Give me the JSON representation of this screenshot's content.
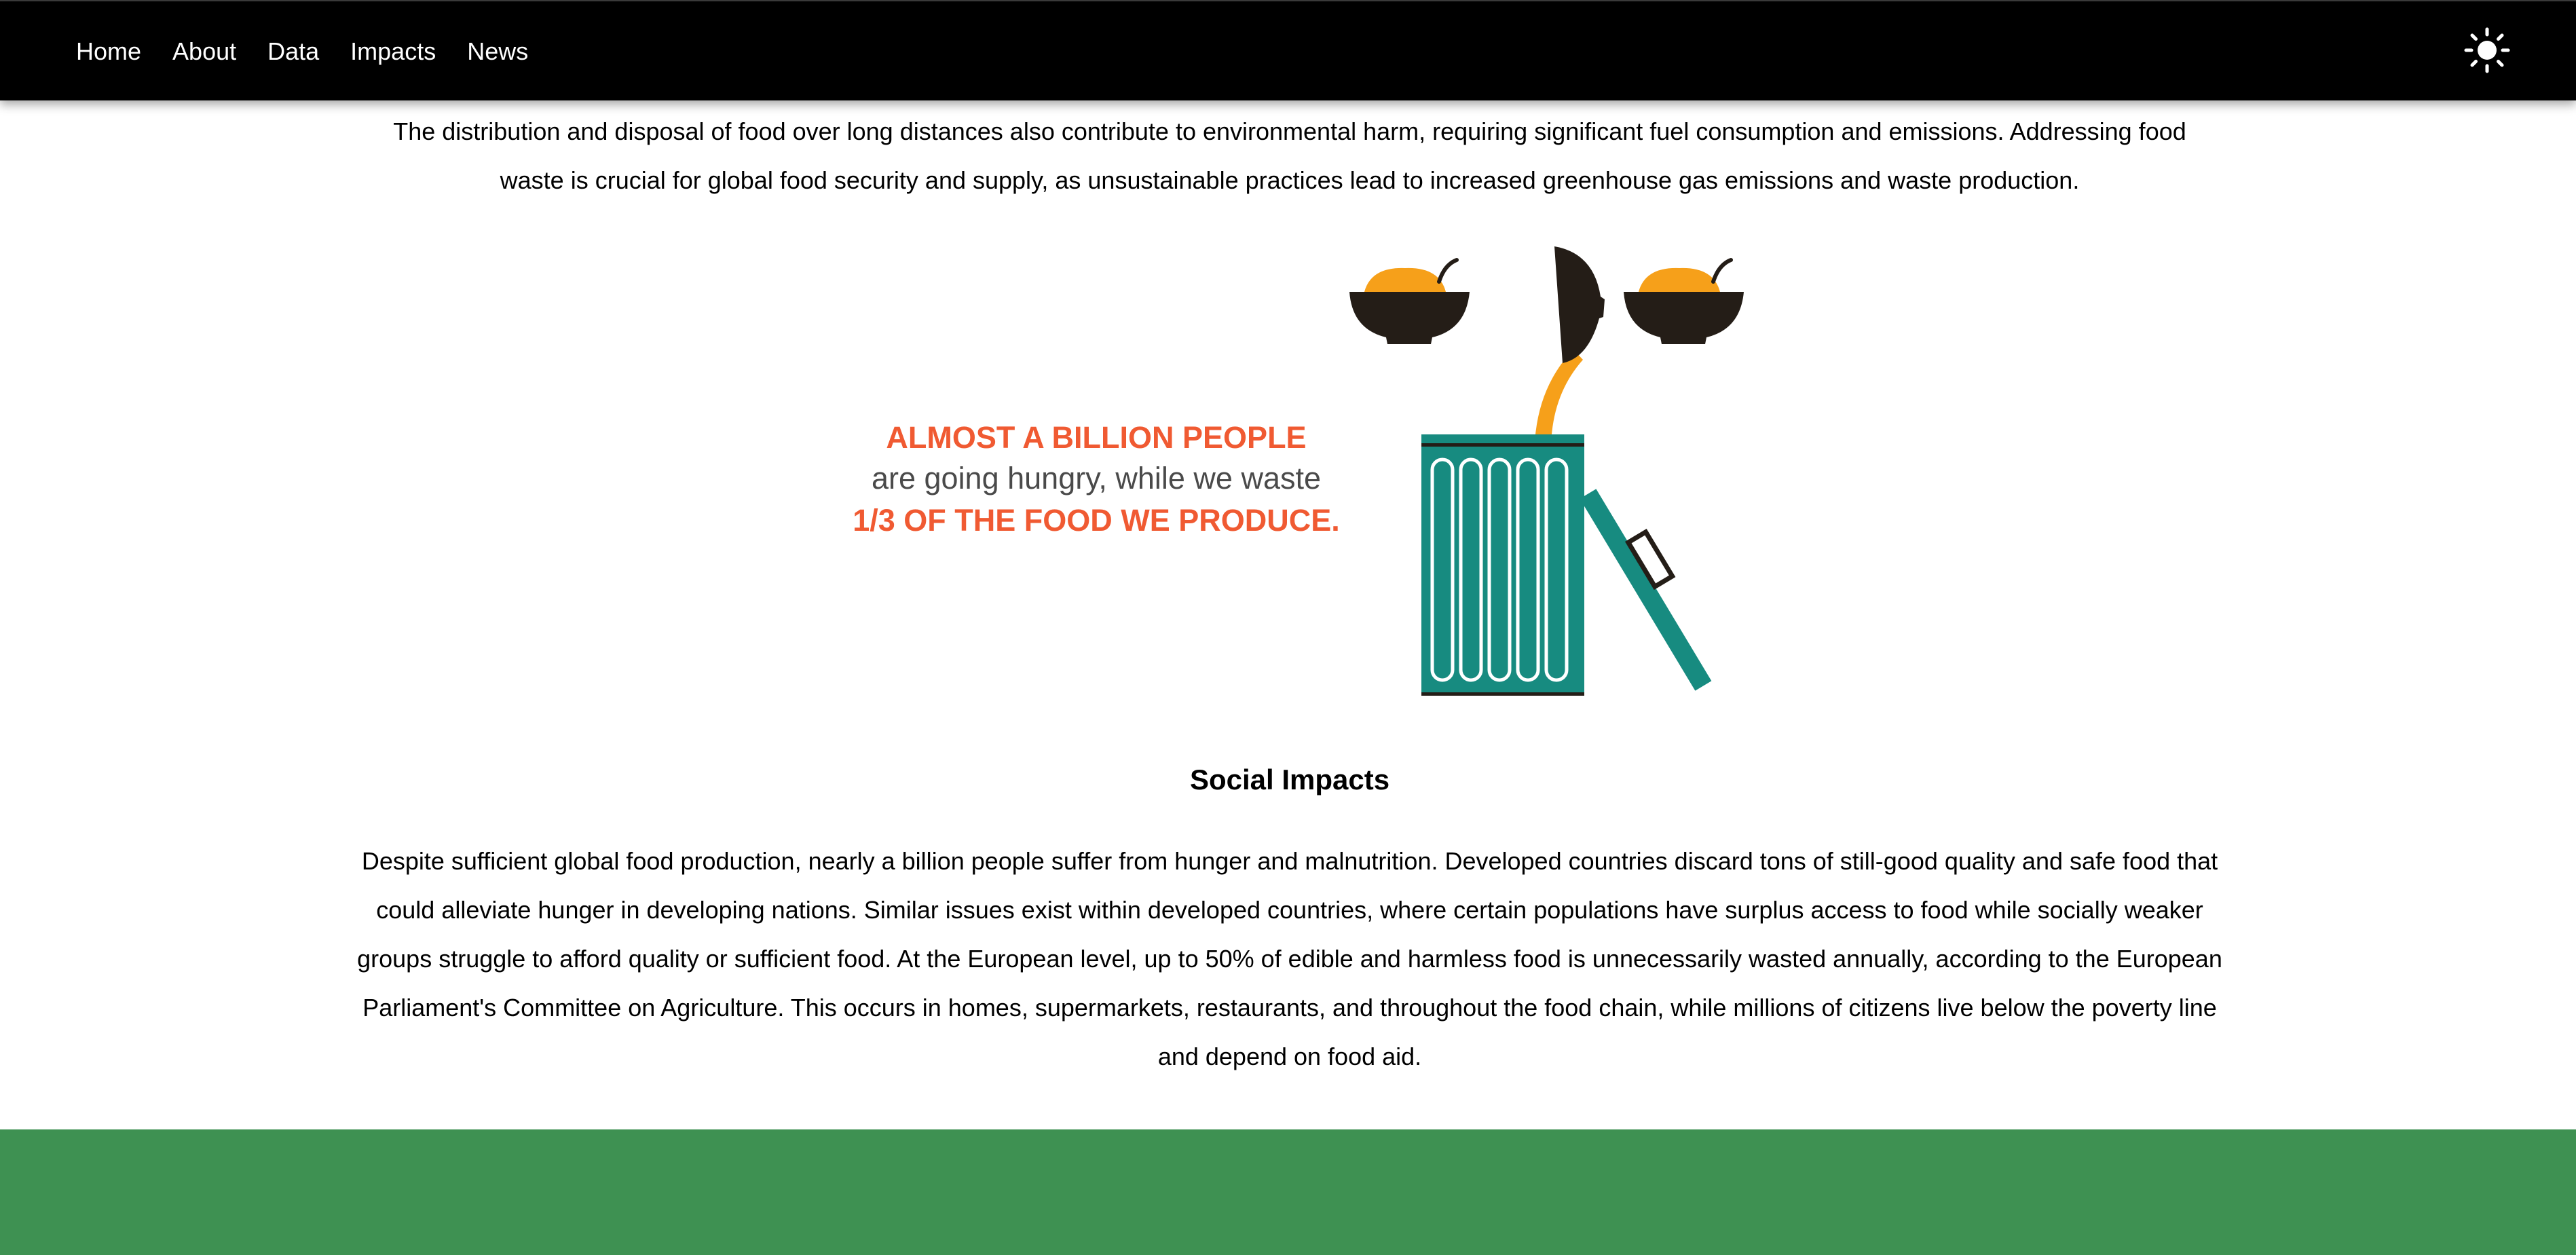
{
  "nav": {
    "links": [
      "Home",
      "About",
      "Data",
      "Impacts",
      "News"
    ],
    "theme_toggle_icon": "sun-icon"
  },
  "intro": {
    "paragraph": "The distribution and disposal of food over long distances also contribute to environmental harm, requiring significant fuel consumption and emissions. Addressing food waste is crucial for global food security and supply, as unsustainable practices lead to increased greenhouse gas emissions and waste production."
  },
  "infographic": {
    "line1": "ALMOST A BILLION PEOPLE",
    "line2": "are going hungry, while we waste",
    "line3": "1/3 OF THE FOOD WE PRODUCE.",
    "icons": [
      "food-bowl-icon",
      "pouring-bowl-icon",
      "food-bowl-icon",
      "trash-bin-icon"
    ]
  },
  "social": {
    "heading": "Social Impacts",
    "paragraph": "Despite sufficient global food production, nearly a billion people suffer from hunger and malnutrition. Developed countries discard tons of still-good quality and safe food that could alleviate hunger in developing nations. Similar issues exist within developed countries, where certain populations have surplus access to food while socially weaker groups struggle to afford quality or sufficient food. At the European level, up to 50% of edible and harmless food is unnecessarily wasted annually, according to the European Parliament's Committee on Agriculture. This occurs in homes, supermarkets, restaurants, and throughout the food chain, while millions of citizens live below the poverty line and depend on food aid."
  },
  "colors": {
    "navbar": "#000000",
    "accent_orange": "#f05a32",
    "food_yellow": "#f6a01a",
    "bowl_dark": "#241d17",
    "bin_teal": "#178b80",
    "footer_green": "#3e9152"
  }
}
